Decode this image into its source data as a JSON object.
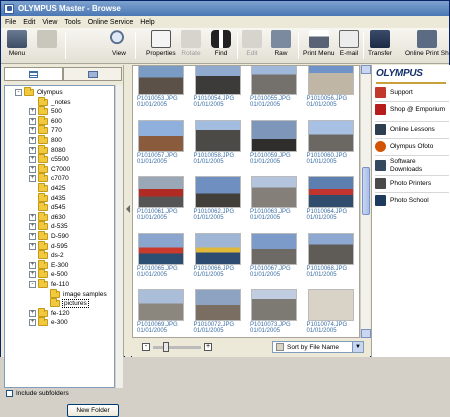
{
  "window": {
    "title": "OLYMPUS Master - Browse"
  },
  "menu": [
    "File",
    "Edit",
    "View",
    "Tools",
    "Online Service",
    "Help"
  ],
  "toolbar": {
    "menu": "Menu",
    "view": "View",
    "properties": "Properties",
    "rotate": "Rotate",
    "find": "Find",
    "edit": "Edit",
    "raw": "Raw",
    "print_menu": "Print Menu",
    "email": "E-mail",
    "transfer": "Transfer",
    "online_print": "Online Print Sh"
  },
  "tree": {
    "items": [
      {
        "label": "Olympus",
        "expand": "-"
      },
      {
        "label": "_notes",
        "expand": ""
      },
      {
        "label": "500",
        "expand": "+"
      },
      {
        "label": "600",
        "expand": "+"
      },
      {
        "label": "770",
        "expand": "+"
      },
      {
        "label": "800",
        "expand": "+"
      },
      {
        "label": "8080",
        "expand": "+"
      },
      {
        "label": "c5500",
        "expand": "+"
      },
      {
        "label": "C7000",
        "expand": "+"
      },
      {
        "label": "c7070",
        "expand": "+"
      },
      {
        "label": "d425",
        "expand": ""
      },
      {
        "label": "d435",
        "expand": ""
      },
      {
        "label": "d545",
        "expand": ""
      },
      {
        "label": "d630",
        "expand": "+"
      },
      {
        "label": "d-535",
        "expand": "+"
      },
      {
        "label": "D-590",
        "expand": "+"
      },
      {
        "label": "d-595",
        "expand": "+"
      },
      {
        "label": "ds-2",
        "expand": ""
      },
      {
        "label": "E-300",
        "expand": "+"
      },
      {
        "label": "e-500",
        "expand": "+"
      },
      {
        "label": "fe-110",
        "expand": "-"
      },
      {
        "label": "image samples",
        "expand": ""
      },
      {
        "label": "pictures",
        "expand": ""
      },
      {
        "label": "fe-120",
        "expand": "+"
      },
      {
        "label": "e-300",
        "expand": "+"
      }
    ],
    "include_subfolders": "Include subfolders",
    "new_folder": "New Folder"
  },
  "grid": {
    "thumbs": [
      {
        "file": "P1010053.JPG",
        "date": "01/01/2005"
      },
      {
        "file": "P1010054.JPG",
        "date": "01/01/2005"
      },
      {
        "file": "P1010055.JPG",
        "date": "01/01/2005"
      },
      {
        "file": "P1010056.JPG",
        "date": "01/01/2005"
      },
      {
        "file": "P1010057.JPG",
        "date": "01/01/2005"
      },
      {
        "file": "P1010058.JPG",
        "date": "01/01/2005"
      },
      {
        "file": "P1010059.JPG",
        "date": "01/01/2005"
      },
      {
        "file": "P1010060.JPG",
        "date": "01/01/2005"
      },
      {
        "file": "P1010061.JPG",
        "date": "01/01/2005"
      },
      {
        "file": "P1010062.JPG",
        "date": "01/01/2005"
      },
      {
        "file": "P1010063.JPG",
        "date": "01/01/2005"
      },
      {
        "file": "P1010064.JPG",
        "date": "01/01/2005"
      },
      {
        "file": "P1010065.JPG",
        "date": "01/01/2005"
      },
      {
        "file": "P1010066.JPG",
        "date": "01/01/2005"
      },
      {
        "file": "P1010067.JPG",
        "date": "01/01/2005"
      },
      {
        "file": "P1010068.JPG",
        "date": "01/01/2005"
      },
      {
        "file": "P1010069.JPG",
        "date": "01/01/2005"
      },
      {
        "file": "P1010072.JPG",
        "date": "01/01/2005"
      },
      {
        "file": "P1010073.JPG",
        "date": "01/01/2005"
      },
      {
        "file": "P1010074.JPG",
        "date": "01/01/2005"
      }
    ],
    "sort_label": "Sort by File Name"
  },
  "right": {
    "logo": "OLYMPUS",
    "items": [
      {
        "label": "Support"
      },
      {
        "label": "Shop @ Emporium"
      },
      {
        "label": "Online Lessons"
      },
      {
        "label": "Olympus Ofoto"
      },
      {
        "label": "Software Downloads"
      },
      {
        "label": "Photo Printers"
      },
      {
        "label": "Photo School"
      }
    ]
  }
}
